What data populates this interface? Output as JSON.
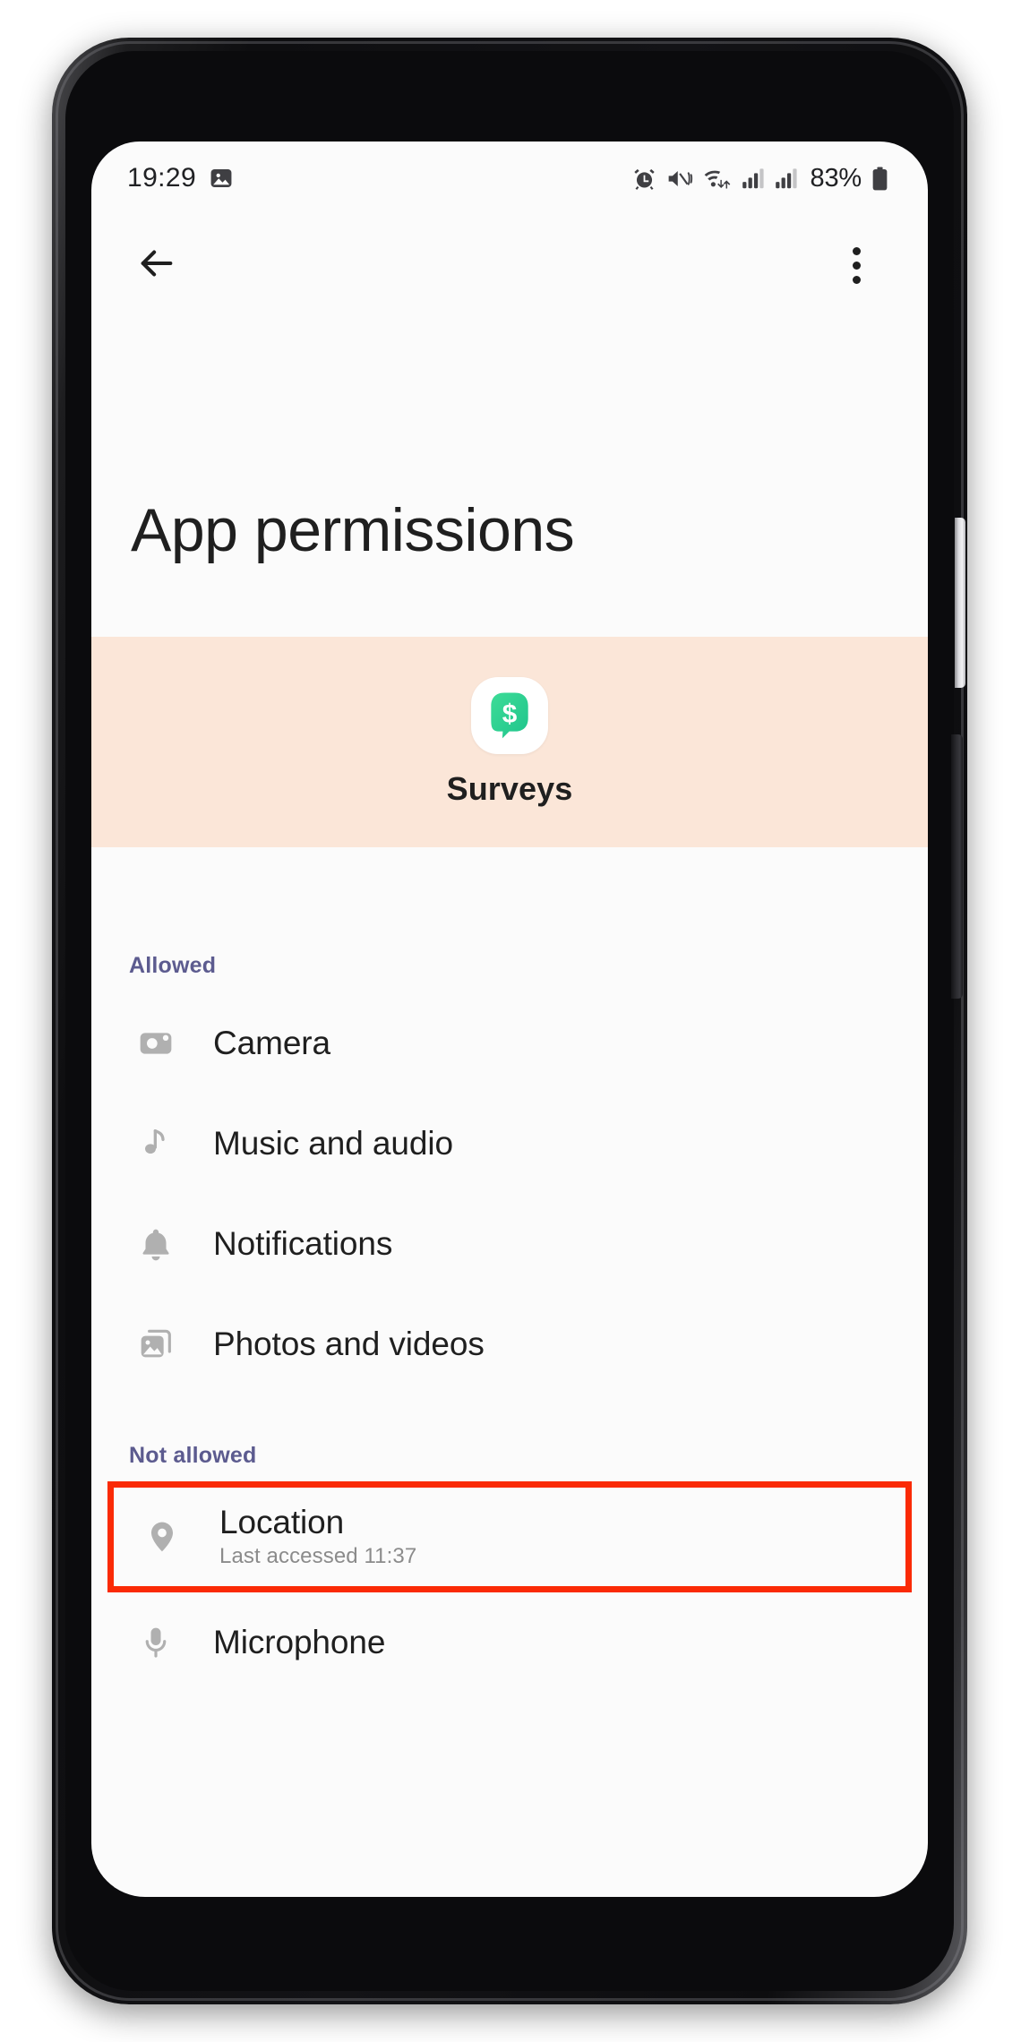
{
  "status_bar": {
    "clock": "19:29",
    "battery_percent": "83%",
    "icons": [
      "image-icon",
      "alarm-icon",
      "mute-vibrate-icon",
      "wifi-data-icon",
      "signal-bars-icon",
      "signal-bars-2-icon",
      "battery-icon"
    ]
  },
  "app_bar": {
    "back_icon": "arrow-back-icon",
    "overflow_icon": "more-vert-icon"
  },
  "page": {
    "title": "App permissions"
  },
  "app_banner": {
    "app_name": "Surveys",
    "app_icon": "surveys-dollar-chat-icon",
    "background_color": "#fbe6d8"
  },
  "sections": [
    {
      "header": "Allowed",
      "items": [
        {
          "label": "Camera",
          "icon": "camera-icon",
          "subtitle": ""
        },
        {
          "label": "Music and audio",
          "icon": "music-note-icon",
          "subtitle": ""
        },
        {
          "label": "Notifications",
          "icon": "bell-icon",
          "subtitle": ""
        },
        {
          "label": "Photos and videos",
          "icon": "photo-library-icon",
          "subtitle": ""
        }
      ]
    },
    {
      "header": "Not allowed",
      "items": [
        {
          "label": "Location",
          "icon": "location-pin-icon",
          "subtitle": "Last accessed 11:37",
          "highlighted": true
        },
        {
          "label": "Microphone",
          "icon": "microphone-icon",
          "subtitle": ""
        }
      ]
    }
  ],
  "colors": {
    "section_header": "#5c5b8f",
    "highlight_border": "#fa2a05",
    "banner_bg": "#fbe6d8",
    "app_icon_green": "#2ecc8f",
    "icon_grey": "#b0b0b0",
    "text_primary": "#1f1f1f",
    "text_secondary": "#8b8b8b"
  }
}
